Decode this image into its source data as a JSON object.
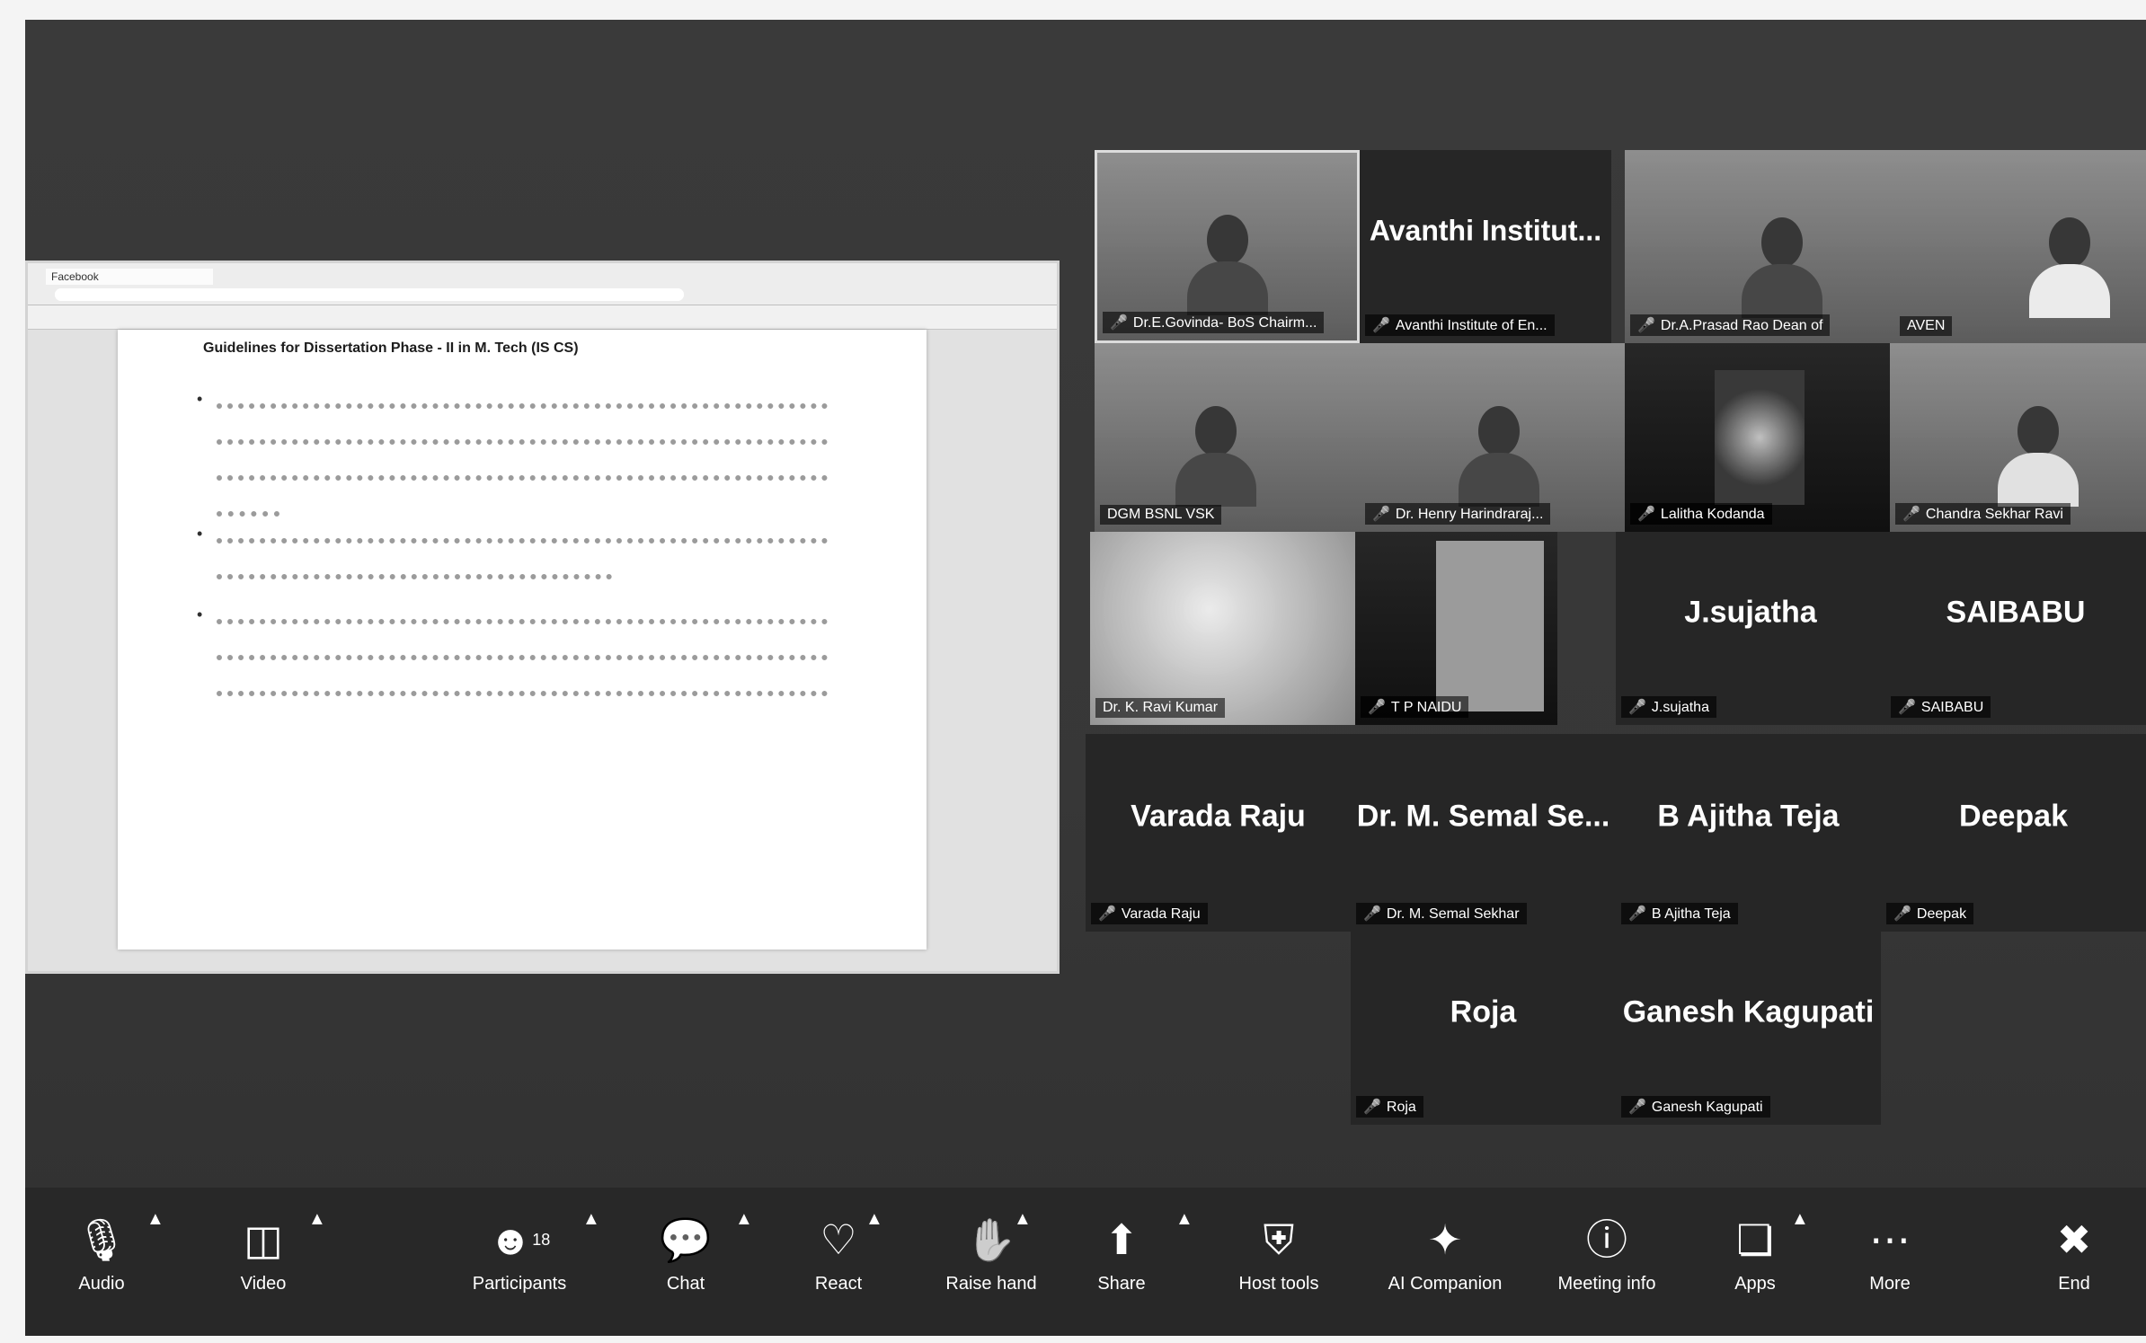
{
  "shared_screen": {
    "tab_title": "Facebook",
    "doc_title": "Guidelines for Dissertation Phase - II in M. Tech (IS CS)"
  },
  "gallery": [
    {
      "big_name": "",
      "tag": "Dr.E.Govinda- BoS Chairm...",
      "type": "video"
    },
    {
      "big_name": "Avanthi Institut...",
      "tag": "Avanthi Institute of En...",
      "type": "name"
    },
    {
      "big_name": "",
      "tag": "Dr.A.Prasad Rao Dean of",
      "type": "video"
    },
    {
      "big_name": "",
      "tag": "AVEN",
      "type": "video"
    },
    {
      "big_name": "",
      "tag": "DGM BSNL VSK",
      "type": "video"
    },
    {
      "big_name": "",
      "tag": "Dr. Henry Harindraraj...",
      "type": "video"
    },
    {
      "big_name": "",
      "tag": "Lalitha Kodanda",
      "type": "video"
    },
    {
      "big_name": "",
      "tag": "Chandra Sekhar Ravi",
      "type": "video"
    },
    {
      "big_name": "",
      "tag": "Dr. K. Ravi Kumar",
      "type": "video"
    },
    {
      "big_name": "",
      "tag": "T P NAIDU",
      "type": "video"
    },
    {
      "big_name": "J.sujatha",
      "tag": "J.sujatha",
      "type": "name"
    },
    {
      "big_name": "SAIBABU",
      "tag": "SAIBABU",
      "type": "name"
    },
    {
      "big_name": "Varada Raju",
      "tag": "Varada Raju",
      "type": "name"
    },
    {
      "big_name": "Dr. M. Semal Se...",
      "tag": "Dr. M. Semal Sekhar",
      "type": "name"
    },
    {
      "big_name": "B Ajitha Teja",
      "tag": "B Ajitha Teja",
      "type": "name"
    },
    {
      "big_name": "Deepak",
      "tag": "Deepak",
      "type": "name"
    },
    {
      "big_name": "Roja",
      "tag": "Roja",
      "type": "name"
    },
    {
      "big_name": "Ganesh Kagupati",
      "tag": "Ganesh Kagupati",
      "type": "name"
    }
  ],
  "toolbar": {
    "audio": "Audio",
    "video": "Video",
    "participants": "Participants",
    "participants_count": "18",
    "chat": "Chat",
    "react": "React",
    "raise_hand": "Raise hand",
    "share": "Share",
    "host_tools": "Host tools",
    "ai_companion": "AI Companion",
    "meeting_info": "Meeting info",
    "apps": "Apps",
    "more": "More",
    "end": "End"
  }
}
